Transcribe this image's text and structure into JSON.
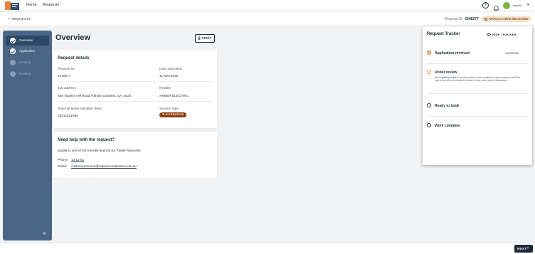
{
  "topnav": {
    "links": [
      "Home",
      "Requests"
    ],
    "user_name": "Jody M."
  },
  "subbar": {
    "back_label": "REQUESTS",
    "request_id_label": "Request ID:",
    "request_id": "2248277",
    "status": "APPLICATION RECEIVED"
  },
  "sidebar": {
    "steps": [
      {
        "label": "Overview",
        "state": "done-active"
      },
      {
        "label": "Application",
        "state": "done"
      },
      {
        "label": "Scoping",
        "state": "todo"
      },
      {
        "label": "Booking",
        "state": "todo"
      }
    ],
    "collapse_glyph": "«"
  },
  "main": {
    "title": "Overview",
    "print_label": "PRINT",
    "details": {
      "heading": "Request details",
      "request_id_label": "Request ID",
      "request_id": "2248277",
      "date_label": "Date submitted",
      "date": "11-Mar-2026",
      "address_label": "Job address",
      "address": "545 Tapleys Hill Road Fulham Gardens, SA, 5024",
      "retailer_label": "Retailer",
      "retailer": "AMBER ELECTRIC",
      "nmi_label": "National Meter Identifier (NMI)",
      "nmi": "20012251984",
      "service_label": "Service Type",
      "service": "ALTERATION"
    },
    "help": {
      "heading": "Need help with the request?",
      "text": "Speak to one of the friendly team at SA Power Networks.",
      "phone_label": "Phone:",
      "phone": "13 12 61",
      "email_label": "Email:",
      "email": "customerservice@sapowernetworks.com.au"
    }
  },
  "tracker": {
    "title": "Request Tracker",
    "hide_label": "HIDE TRACKER",
    "items": [
      {
        "label": "Application received",
        "date": "11/03/2026",
        "state": "done"
      },
      {
        "label": "Under review",
        "desc": "We're getting ready to scope out the work needed for your request. We'll let you know when its ready to book or if we need more information.",
        "state": "current"
      },
      {
        "label": "Ready to book",
        "state": "todo"
      },
      {
        "label": "Work complete",
        "state": "todo"
      }
    ]
  },
  "bottombar": {
    "next_label": "NEXT"
  },
  "colors": {
    "sidebar": "#4a6585",
    "accent": "#e8873a",
    "badge": "#8a3d0c",
    "primary": "#1d2a3a"
  }
}
